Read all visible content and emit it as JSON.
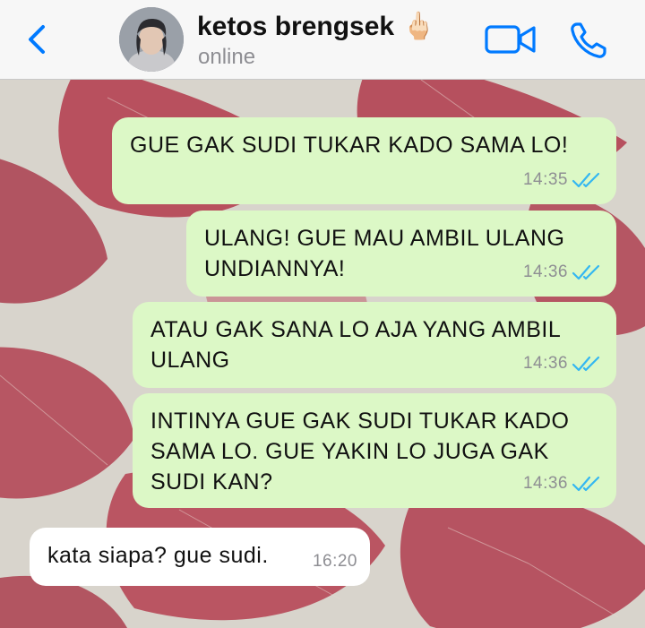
{
  "header": {
    "contact_name": "ketos brengsek",
    "contact_emoji": "🖕🏻",
    "status": "online",
    "icons": {
      "back": "chevron-left-icon",
      "video": "video-call-icon",
      "call": "phone-icon"
    },
    "accent_color": "#007aff"
  },
  "messages": [
    {
      "direction": "outgoing",
      "text": "GUE GAK SUDI TUKAR KADO SAMA LO!",
      "time": "14:35",
      "status": "read"
    },
    {
      "direction": "outgoing",
      "text": "ULANG! GUE MAU AMBIL ULANG UNDIANNYA!",
      "time": "14:36",
      "status": "read"
    },
    {
      "direction": "outgoing",
      "text": "ATAU GAK SANA LO AJA YANG AMBIL ULANG",
      "time": "14:36",
      "status": "read"
    },
    {
      "direction": "outgoing",
      "text": "INTINYA GUE GAK SUDI TUKAR KADO SAMA LO. GUE YAKIN LO JUGA GAK SUDI KAN?",
      "time": "14:36",
      "status": "read"
    },
    {
      "direction": "incoming",
      "text": "kata siapa? gue sudi.",
      "time": "16:20"
    }
  ],
  "colors": {
    "outgoing_bubble": "#dcf8c6",
    "incoming_bubble": "#ffffff",
    "read_tick": "#34b7f1"
  }
}
